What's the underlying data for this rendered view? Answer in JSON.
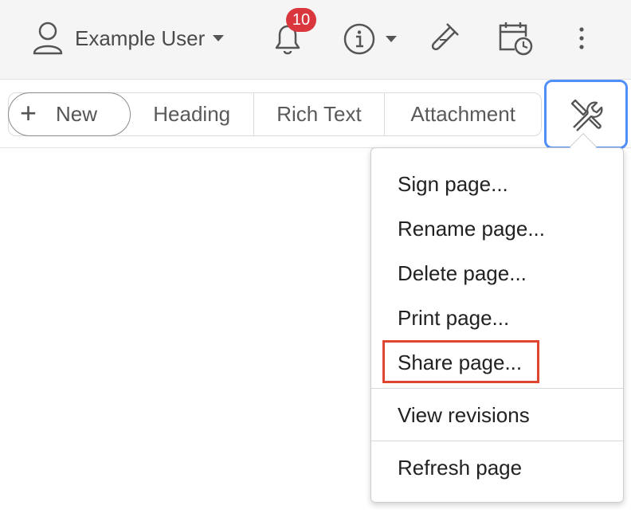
{
  "header": {
    "user_name": "Example User",
    "notification_count": "10"
  },
  "toolbar": {
    "new_label": "New",
    "heading_label": "Heading",
    "rich_text_label": "Rich Text",
    "attachment_label": "Attachment"
  },
  "menu": {
    "items": [
      "Sign page...",
      "Rename page...",
      "Delete page...",
      "Print page...",
      "Share page...",
      "View revisions",
      "Refresh page"
    ]
  },
  "colors": {
    "badge": "#d9363e",
    "tools_focus": "#4f8ff7",
    "highlight": "#e0452f"
  },
  "icons": [
    "user-icon",
    "bell-icon",
    "info-icon",
    "flask-icon",
    "calendar-clock-icon",
    "kebab-icon",
    "plus-icon",
    "tools-icon"
  ]
}
